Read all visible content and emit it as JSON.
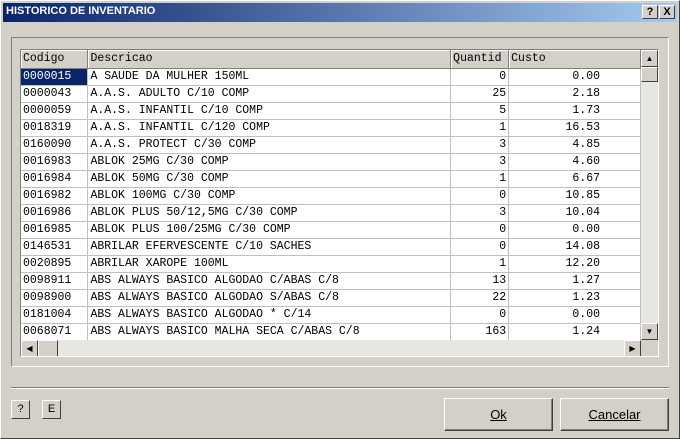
{
  "window": {
    "title": "HISTORICO DE INVENTARIO",
    "help_glyph": "?",
    "close_glyph": "X"
  },
  "grid": {
    "columns": [
      "Codigo",
      "Descricao",
      "Quantid",
      "Custo"
    ],
    "rows": [
      [
        "0000015",
        "A SAUDE DA MULHER 150ML",
        "0",
        "0.00"
      ],
      [
        "0000043",
        "A.A.S. ADULTO  C/10 COMP",
        "25",
        "2.18"
      ],
      [
        "0000059",
        "A.A.S. INFANTIL  C/10 COMP",
        "5",
        "1.73"
      ],
      [
        "0018319",
        "A.A.S. INFANTIL  C/120 COMP",
        "1",
        "16.53"
      ],
      [
        "0160090",
        "A.A.S. PROTECT C/30 COMP",
        "3",
        "4.85"
      ],
      [
        "0016983",
        "ABLOK  25MG C/30 COMP",
        "3",
        "4.60"
      ],
      [
        "0016984",
        "ABLOK  50MG C/30 COMP",
        "1",
        "6.67"
      ],
      [
        "0016982",
        "ABLOK 100MG C/30 COMP",
        "0",
        "10.85"
      ],
      [
        "0016986",
        "ABLOK PLUS  50/12,5MG C/30 COMP",
        "3",
        "10.04"
      ],
      [
        "0016985",
        "ABLOK PLUS 100/25MG C/30 COMP",
        "0",
        "0.00"
      ],
      [
        "0146531",
        "ABRILAR EFERVESCENTE C/10 SACHES",
        "0",
        "14.08"
      ],
      [
        "0020895",
        "ABRILAR XAROPE 100ML",
        "1",
        "12.20"
      ],
      [
        "0098911",
        "ABS ALWAYS BASICO ALGODAO  C/ABAS C/8",
        "13",
        "1.27"
      ],
      [
        "0098900",
        "ABS ALWAYS BASICO ALGODAO  S/ABAS C/8",
        "22",
        "1.23"
      ],
      [
        "0181004",
        "ABS ALWAYS BASICO ALGODAO * C/14",
        "0",
        "0.00"
      ],
      [
        "0068071",
        "ABS ALWAYS BASICO MALHA SECA  C/ABAS C/8",
        "163",
        "1.24"
      ]
    ],
    "selected_row": 0,
    "scroll_up_glyph": "▲",
    "scroll_down_glyph": "▼",
    "scroll_left_glyph": "◀",
    "scroll_right_glyph": "▶"
  },
  "footer": {
    "help_label": "?",
    "e_label": "E",
    "ok_label": "Ok",
    "cancel_label": "Cancelar"
  },
  "colors": {
    "title_start": "#0a246a",
    "title_end": "#a6caf0",
    "selection": "#0a246a",
    "face": "#d4d0c8"
  }
}
